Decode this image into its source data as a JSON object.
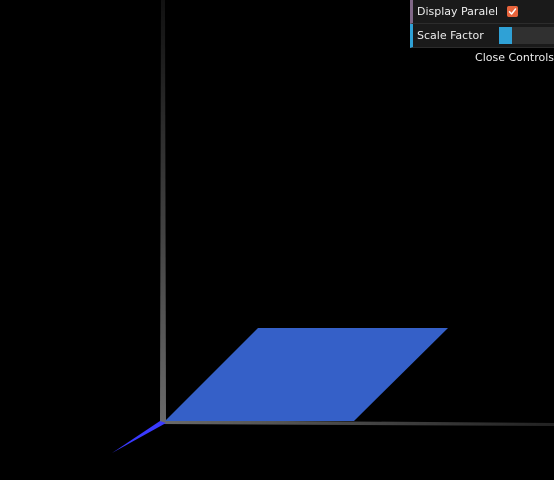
{
  "gui": {
    "display_paralel_label": "Display Paralel",
    "display_paralel_checked": true,
    "scale_factor_label": "Scale Factor",
    "scale_factor_fraction": 0.25,
    "close_label": "Close Controls"
  },
  "scene": {
    "background_color": "#000000",
    "parallelogram_color": "#3560c8",
    "vector_color": "#3a3aff",
    "axis_color": "#5a5a5a"
  }
}
